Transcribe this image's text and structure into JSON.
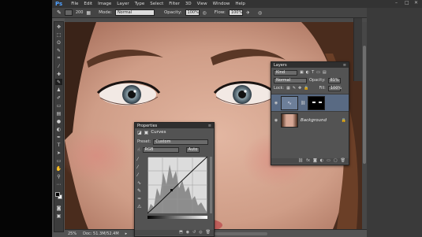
{
  "app": {
    "logo": "Ps"
  },
  "menu": [
    "File",
    "Edit",
    "Image",
    "Layer",
    "Type",
    "Select",
    "Filter",
    "3D",
    "View",
    "Window",
    "Help"
  ],
  "options": {
    "brush_size": "200",
    "mode_label": "Mode:",
    "mode_value": "Normal",
    "opacity_label": "Opacity:",
    "opacity_value": "100%",
    "flow_label": "Flow:",
    "flow_value": "100%"
  },
  "status": {
    "zoom": "25%",
    "doc": "Doc: 51.3M/52.4M"
  },
  "properties": {
    "title": "Properties",
    "adjustment": "Curves",
    "preset_label": "Preset:",
    "preset_value": "Custom",
    "channel_value": "RGB",
    "auto_label": "Auto"
  },
  "layers": {
    "title": "Layers",
    "kind_value": "Kind",
    "blend_value": "Normal",
    "opacity_label": "Opacity:",
    "opacity_value": "81%",
    "lock_label": "Lock:",
    "fill_label": "Fill:",
    "fill_value": "100%",
    "background_layer": "Background"
  },
  "colors": {
    "accent": "#596a83",
    "panel": "#535353",
    "ps_blue": "#4fa0ff"
  }
}
